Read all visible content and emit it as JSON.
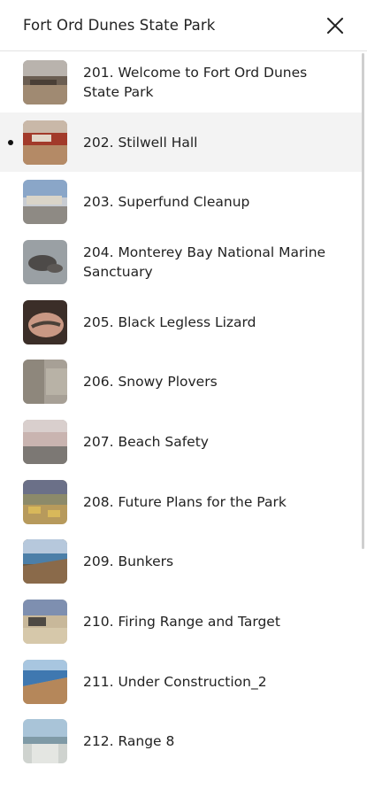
{
  "header": {
    "title": "Fort Ord Dunes State Park",
    "close_icon": "close-icon"
  },
  "stops": [
    {
      "label": "201. Welcome to Fort Ord Dunes State Park",
      "active": false
    },
    {
      "label": "202. Stilwell Hall",
      "active": true
    },
    {
      "label": "203. Superfund Cleanup",
      "active": false
    },
    {
      "label": "204. Monterey Bay National Marine Sanctuary",
      "active": false
    },
    {
      "label": "205. Black Legless Lizard",
      "active": false
    },
    {
      "label": "206. Snowy Plovers",
      "active": false
    },
    {
      "label": "207. Beach Safety",
      "active": false
    },
    {
      "label": "208. Future Plans for the Park",
      "active": false
    },
    {
      "label": "209. Bunkers",
      "active": false
    },
    {
      "label": "210. Firing Range and Target",
      "active": false
    },
    {
      "label": "211. Under Construction_2",
      "active": false
    },
    {
      "label": "212. Range 8",
      "active": false
    }
  ]
}
